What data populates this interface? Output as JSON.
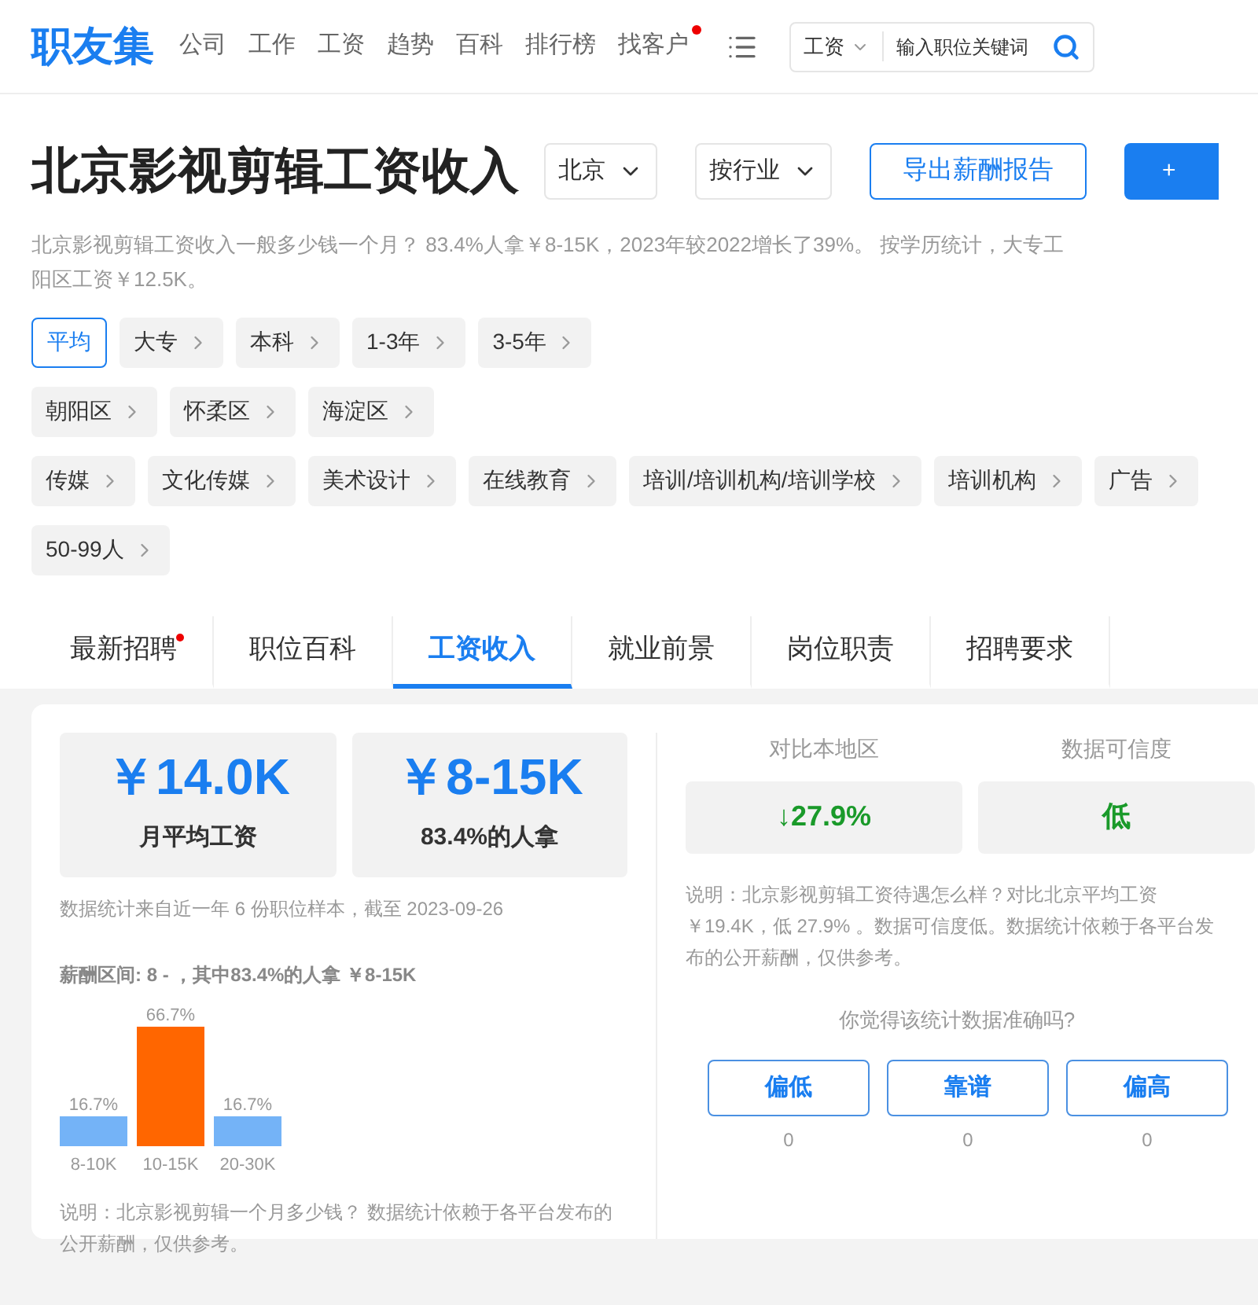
{
  "header": {
    "logo": "职友集",
    "nav": [
      {
        "label": "公司",
        "dot": false
      },
      {
        "label": "工作",
        "dot": false
      },
      {
        "label": "工资",
        "dot": false
      },
      {
        "label": "趋势",
        "dot": false
      },
      {
        "label": "百科",
        "dot": false
      },
      {
        "label": "排行榜",
        "dot": false
      },
      {
        "label": "找客户",
        "dot": true
      }
    ],
    "search": {
      "category": "工资",
      "placeholder": "输入职位关键词"
    }
  },
  "title": {
    "text": "北京影视剪辑工资收入",
    "dropdowns": [
      "北京",
      "按行业"
    ],
    "export_button": "导出薪酬报告",
    "add_button": "+"
  },
  "description": [
    "北京影视剪辑工资收入一般多少钱一个月？ 83.4%人拿￥8-15K，2023年较2022增长了39%。 按学历统计，大专工",
    "阳区工资￥12.5K。"
  ],
  "tag_rows": [
    [
      {
        "label": "平均",
        "selected": true
      },
      {
        "label": "大专",
        "selected": false
      },
      {
        "label": "本科",
        "selected": false
      },
      {
        "label": "1-3年",
        "selected": false
      },
      {
        "label": "3-5年",
        "selected": false
      }
    ],
    [
      {
        "label": "朝阳区",
        "selected": false
      },
      {
        "label": "怀柔区",
        "selected": false
      },
      {
        "label": "海淀区",
        "selected": false
      }
    ],
    [
      {
        "label": "传媒",
        "selected": false
      },
      {
        "label": "文化传媒",
        "selected": false
      },
      {
        "label": "美术设计",
        "selected": false
      },
      {
        "label": "在线教育",
        "selected": false
      },
      {
        "label": "培训/培训机构/培训学校",
        "selected": false
      },
      {
        "label": "培训机构",
        "selected": false
      },
      {
        "label": "广告",
        "selected": false
      }
    ],
    [
      {
        "label": "50-99人",
        "selected": false
      }
    ]
  ],
  "tabs": [
    {
      "label": "最新招聘",
      "selected": false,
      "dot": true
    },
    {
      "label": "职位百科",
      "selected": false,
      "dot": false
    },
    {
      "label": "工资收入",
      "selected": true,
      "dot": false
    },
    {
      "label": "就业前景",
      "selected": false,
      "dot": false
    },
    {
      "label": "岗位职责",
      "selected": false,
      "dot": false
    },
    {
      "label": "招聘要求",
      "selected": false,
      "dot": false
    }
  ],
  "stats": [
    {
      "value": "￥14.0K",
      "label": "月平均工资"
    },
    {
      "value": "￥8-15K",
      "label": "83.4%的人拿"
    }
  ],
  "sample_note": "数据统计来自近一年 6 份职位样本，截至 2023-09-26",
  "range_title": "薪酬区间: 8 - ，其中83.4%的人拿 ￥8-15K",
  "chart_data": {
    "type": "bar",
    "categories": [
      "8-10K",
      "10-15K",
      "20-30K"
    ],
    "series": [
      {
        "color": "#74b3f7",
        "values": [
          16.7,
          null,
          16.7
        ],
        "value_labels": [
          "16.7%",
          null,
          "16.7%"
        ]
      },
      {
        "color": "#ff6600",
        "values": [
          null,
          66.7,
          null
        ],
        "value_labels": [
          null,
          "66.7%",
          null
        ]
      }
    ]
  },
  "chart_note": "说明：北京影视剪辑一个月多少钱？ 数据统计依赖于各平台发布的公开薪酬，仅供参考。",
  "compare": [
    {
      "title": "对比本地区",
      "value": "↓27.9%"
    },
    {
      "title": "数据可信度",
      "value": "低"
    }
  ],
  "compare_note": "说明：北京影视剪辑工资待遇怎么样？对比北京平均工资￥19.4K，低 27.9% 。数据可信度低。数据统计依赖于各平台发布的公开薪酬，仅供参考。",
  "feedback": {
    "question": "你觉得该统计数据准确吗?",
    "options": [
      {
        "label": "偏低",
        "count": "0"
      },
      {
        "label": "靠谱",
        "count": "0"
      },
      {
        "label": "偏高",
        "count": "0"
      }
    ]
  }
}
